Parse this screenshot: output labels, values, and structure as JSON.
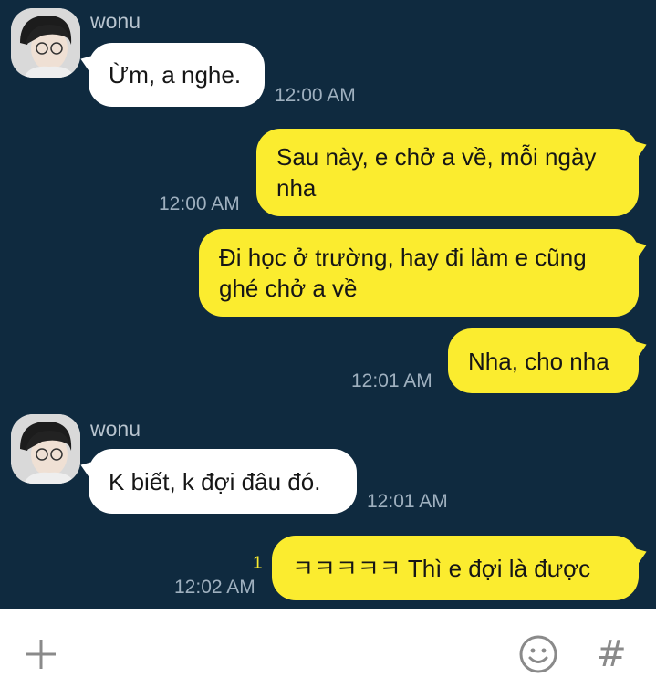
{
  "messages": [
    {
      "type": "in",
      "sender": "wonu",
      "text": "Ừm, a nghe.",
      "time": "12:00 AM"
    },
    {
      "type": "out",
      "text": "Sau này, e chở a về, mỗi ngày nha",
      "time": "12:00 AM"
    },
    {
      "type": "out",
      "text": "Đi học ở trường, hay đi làm e cũng ghé chở a về",
      "time": ""
    },
    {
      "type": "out",
      "text": "Nha, cho nha",
      "time": "12:01 AM"
    },
    {
      "type": "in",
      "sender": "wonu",
      "text": "K biết, k đợi đâu đó.",
      "time": "12:01 AM"
    },
    {
      "type": "out",
      "text": "ㅋㅋㅋㅋㅋ Thì e đợi là được",
      "time": "12:02 AM",
      "unread": "1"
    }
  ],
  "input_bar": {
    "add_icon": "plus-icon",
    "emoji_icon": "smiley-icon",
    "hash_icon": "hash-icon",
    "hash_glyph": "#"
  },
  "colors": {
    "background": "#0f2a3f",
    "outgoing_bubble": "#fbec2f",
    "incoming_bubble": "#ffffff"
  }
}
